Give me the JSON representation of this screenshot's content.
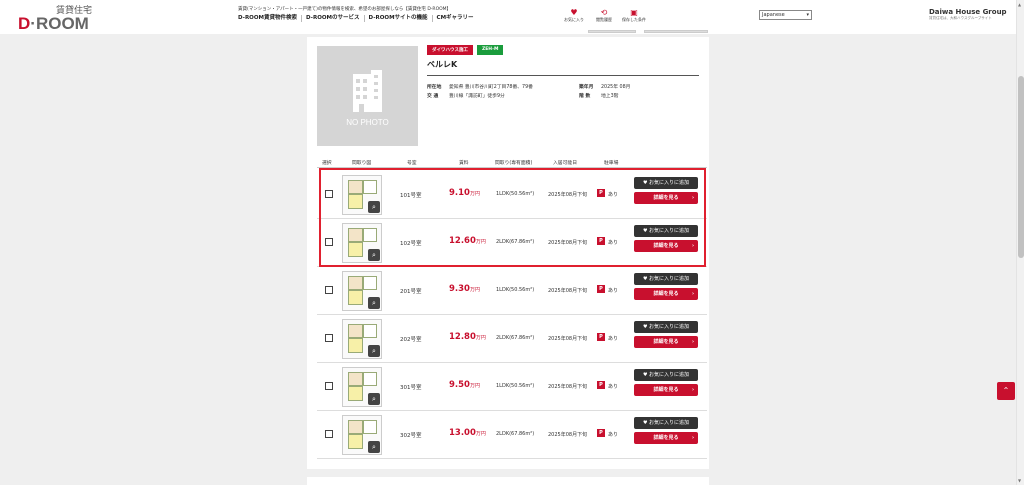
{
  "header": {
    "logo_top": "賃貸住宅",
    "logo_d": "D",
    "logo_rest": "·ROOM",
    "tagline": "賃貸(マンション・アパート・一戸建て)の物件情報を検索、希望のお部屋探しなら【賃貸住宅 D-ROOM】",
    "nav": [
      "D-ROOM賃貸物件検索",
      "D-ROOMのサービス",
      "D-ROOMサイトの機能",
      "CMギャラリー"
    ],
    "icons": [
      {
        "icon": "heart-icon",
        "label": "お気に入り"
      },
      {
        "icon": "history-icon",
        "label": "閲覧履歴"
      },
      {
        "icon": "saved-search-icon",
        "label": "保存した条件"
      }
    ],
    "language": "Japanese",
    "daiwa_brand": "Daiwa House Group",
    "daiwa_sub": "賃貸住宅は、大和ハウスグループサイト"
  },
  "property": {
    "photo_label": "NO PHOTO",
    "badges": [
      {
        "label": "ダイワハウス施工",
        "color": "#c8102e"
      },
      {
        "label": "ZEH-M",
        "color": "#1a9c3c"
      }
    ],
    "name": "ベルレK",
    "address_label": "所在地",
    "address": "愛知県 豊川市谷川町2丁目78番、79番",
    "access_label": "交 通",
    "access": "豊川線「諏訪町」徒歩9分",
    "built_label": "築年月",
    "built": "2025年 08月",
    "floors_label": "階 数",
    "floors": "地上3階"
  },
  "table": {
    "headers": [
      "選択",
      "間取り図",
      "号室",
      "賃料",
      "間取り(専有面積)",
      "入居可能日",
      "駐車場"
    ],
    "rows": [
      {
        "room": "101号室",
        "rent": "9.10",
        "layout": "1LDK(50.56m²)",
        "date": "2025年08月下旬",
        "parking": "あり"
      },
      {
        "room": "102号室",
        "rent": "12.60",
        "layout": "2LDK(67.86m²)",
        "date": "2025年08月下旬",
        "parking": "あり"
      },
      {
        "room": "201号室",
        "rent": "9.30",
        "layout": "1LDK(50.56m²)",
        "date": "2025年08月下旬",
        "parking": "あり"
      },
      {
        "room": "202号室",
        "rent": "12.80",
        "layout": "2LDK(67.86m²)",
        "date": "2025年08月下旬",
        "parking": "あり"
      },
      {
        "room": "301号室",
        "rent": "9.50",
        "layout": "1LDK(50.56m²)",
        "date": "2025年08月下旬",
        "parking": "あり"
      },
      {
        "room": "302号室",
        "rent": "13.00",
        "layout": "2LDK(67.86m²)",
        "date": "2025年08月下旬",
        "parking": "あり"
      }
    ],
    "rent_unit": "万円",
    "parking_badge": "P",
    "fav_label": "お気に入りに追加",
    "detail_label": "詳細を見る"
  },
  "colors": {
    "brand_red": "#c8102e",
    "highlight": "#e0202f"
  }
}
